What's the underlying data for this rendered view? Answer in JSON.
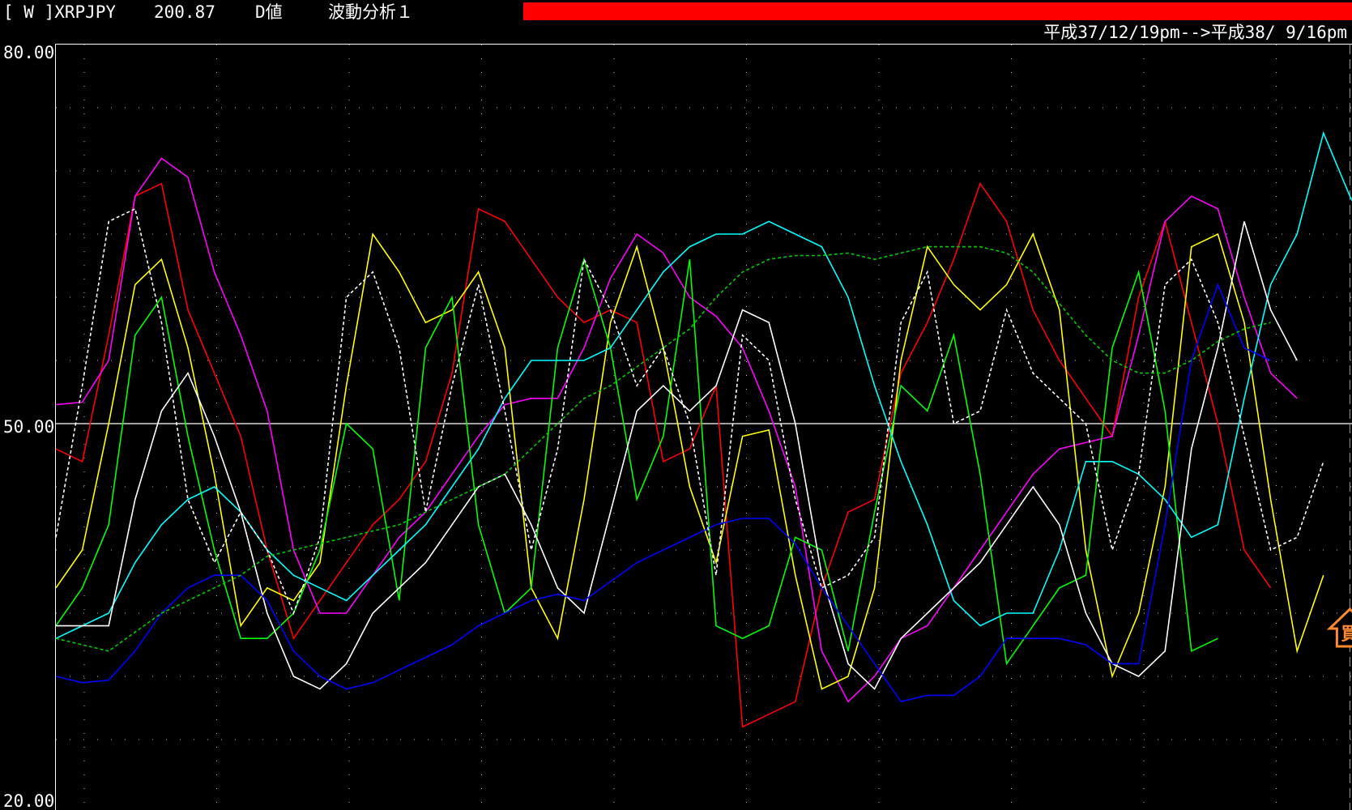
{
  "header": {
    "symbol": "[ W ]XRPJPY",
    "price": "200.87",
    "mode": "D値",
    "analysis": "波動分析１",
    "status_color": "#ff0000",
    "date_range": "平成37/12/19pm-->平成38/ 9/16pm"
  },
  "colors": {
    "background": "#000000",
    "frame": "#ffffff",
    "grid": "#c0c0c0",
    "midline": "#ffffff",
    "cursor": "#9a9a9a",
    "buy_signal": "#ff8a30"
  },
  "signal": {
    "label": "買",
    "icon": "up-arrow-icon",
    "at_x": 49
  },
  "chart_data": {
    "type": "line",
    "title": "",
    "xlabel": "",
    "ylabel": "",
    "ylim": [
      20,
      80
    ],
    "yticks": [
      "80.00",
      "50.00",
      "20.00"
    ],
    "reference_lines": [
      50
    ],
    "grid": true,
    "x": [
      0,
      1,
      2,
      3,
      4,
      5,
      6,
      7,
      8,
      9,
      10,
      11,
      12,
      13,
      14,
      15,
      16,
      17,
      18,
      19,
      20,
      21,
      22,
      23,
      24,
      25,
      26,
      27,
      28,
      29,
      30,
      31,
      32,
      33,
      34,
      35,
      36,
      37,
      38,
      39,
      40,
      41,
      42,
      43,
      44,
      45,
      46,
      47,
      48,
      49,
      50
    ],
    "series": [
      {
        "color": "#ff0000",
        "style": "solid",
        "values": [
          48,
          47,
          57,
          68,
          69,
          59,
          54,
          49,
          40,
          33,
          36,
          39,
          42,
          44,
          47,
          54,
          67,
          66,
          63,
          60,
          58,
          59,
          58,
          47,
          48,
          53,
          26,
          27,
          28,
          37,
          43,
          44,
          54,
          58,
          63,
          69,
          66,
          59,
          55,
          52,
          49,
          60,
          66,
          58,
          50,
          40,
          37
        ]
      },
      {
        "color": "#ff00ff",
        "style": "solid",
        "values": [
          51.5,
          51.7,
          55,
          68,
          71,
          69.5,
          62,
          57,
          51,
          40,
          35,
          35,
          38,
          41,
          43,
          46,
          49,
          51.5,
          52,
          52,
          56,
          61.5,
          65,
          63.5,
          60,
          58.5,
          56,
          51,
          45,
          32,
          28,
          30,
          33,
          34,
          37,
          40,
          43,
          46,
          48,
          48.5,
          49,
          57,
          66,
          68,
          67,
          60,
          54,
          52
        ]
      },
      {
        "color": "#ffff00",
        "style": "solid",
        "values": [
          37,
          40,
          50,
          61,
          63,
          56,
          46,
          34,
          37,
          36,
          39,
          53,
          65,
          62,
          58,
          59,
          62,
          56,
          37,
          33,
          44,
          58,
          64,
          56,
          45,
          39,
          49,
          49.5,
          38,
          29,
          30,
          37,
          55,
          64,
          61,
          59,
          61,
          65,
          59,
          40,
          30,
          35,
          45,
          64,
          65,
          58,
          44,
          32,
          38
        ]
      },
      {
        "color": "#00ff00",
        "style": "solid",
        "values": [
          34,
          37,
          42,
          57,
          60,
          49,
          40,
          33,
          33,
          35,
          40,
          50,
          48,
          36,
          56,
          60,
          42,
          35,
          37,
          56,
          63,
          56,
          44,
          49,
          63,
          34,
          33,
          34,
          41,
          40,
          32,
          43,
          53,
          51,
          57,
          46,
          31,
          34,
          37,
          38,
          56,
          62,
          51,
          32,
          33
        ]
      },
      {
        "color": "#00ffff",
        "style": "solid",
        "values": [
          33,
          34,
          35,
          39,
          42,
          44,
          45,
          43,
          40,
          38,
          37,
          36,
          38,
          40,
          42,
          45,
          48,
          52,
          55,
          55,
          55,
          56,
          59,
          62,
          64,
          65,
          65,
          66,
          65,
          64,
          60,
          53,
          47,
          42,
          36,
          34,
          35,
          35,
          40,
          47,
          47,
          46,
          44,
          41,
          42,
          52,
          61,
          65,
          73,
          68,
          64
        ]
      },
      {
        "color": "#ffffff",
        "style": "solid",
        "values": [
          34,
          34,
          34,
          44,
          51,
          54,
          49,
          43,
          35,
          30,
          29,
          31,
          35,
          37,
          39,
          42,
          45,
          46,
          42,
          37,
          35,
          43,
          51,
          53,
          51,
          53,
          59,
          58,
          50,
          38,
          31,
          29,
          33,
          35,
          37,
          39,
          42,
          45,
          42,
          35,
          31,
          30,
          32,
          48,
          56,
          66,
          59,
          55
        ]
      },
      {
        "color": "#0000ff",
        "style": "solid",
        "values": [
          30,
          29.5,
          29.7,
          32,
          35,
          37,
          38,
          38,
          36,
          32,
          30,
          29,
          29.5,
          30.5,
          31.5,
          32.5,
          34,
          35,
          36,
          36.5,
          36,
          37.5,
          39,
          40,
          41,
          42,
          42.5,
          42.5,
          40.5,
          37,
          34,
          31,
          28,
          28.5,
          28.5,
          30,
          33,
          33,
          33,
          32.5,
          31,
          31,
          42,
          55,
          61,
          56,
          55
        ]
      },
      {
        "color": "#ffffff",
        "style": "dashed",
        "values": [
          41,
          53,
          66,
          67,
          58,
          44,
          39,
          43,
          40,
          35,
          41,
          60,
          62,
          56,
          43,
          53,
          61,
          51,
          40,
          48,
          63,
          59,
          53,
          56,
          50,
          38,
          57,
          55,
          44,
          37,
          38,
          41,
          58,
          62,
          50,
          51,
          59,
          54,
          52,
          50,
          40,
          46,
          61,
          63,
          58,
          49,
          40,
          41,
          47
        ]
      },
      {
        "color": "#00cc00",
        "style": "dashed",
        "values": [
          33,
          32.5,
          32,
          33.5,
          35,
          36,
          37,
          38,
          39.5,
          40,
          40.5,
          41,
          41.5,
          42,
          43,
          44,
          45,
          46,
          48,
          50,
          52,
          53,
          54.5,
          56,
          57.5,
          60,
          62,
          63,
          63.3,
          63.3,
          63.5,
          63,
          63.5,
          64,
          64,
          64,
          63.5,
          62,
          59.5,
          57,
          55,
          54,
          54,
          55,
          56.5,
          57.5,
          58
        ]
      }
    ]
  }
}
